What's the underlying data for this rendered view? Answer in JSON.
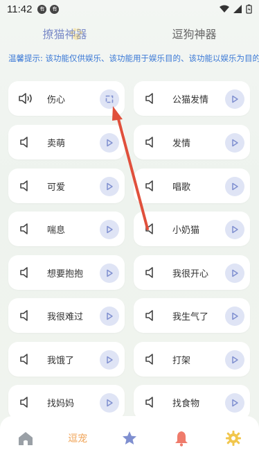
{
  "status": {
    "time": "11:42",
    "dot1": "有",
    "dot2": "有"
  },
  "tabs": [
    {
      "label": "撩猫神器",
      "active": true
    },
    {
      "label": "逗狗神器",
      "active": false
    }
  ],
  "notice": "温馨提示: 该功能仅供娱乐、该功能用于娱乐目的、该功能以娱乐为目的",
  "left_items": [
    {
      "label": "伤心"
    },
    {
      "label": "卖萌"
    },
    {
      "label": "可爱"
    },
    {
      "label": "喘息"
    },
    {
      "label": "想要抱抱"
    },
    {
      "label": "我很难过"
    },
    {
      "label": "我饿了"
    },
    {
      "label": "找妈妈"
    }
  ],
  "right_items": [
    {
      "label": "公猫发情"
    },
    {
      "label": "发情"
    },
    {
      "label": "唱歌"
    },
    {
      "label": "小奶猫"
    },
    {
      "label": "我很开心"
    },
    {
      "label": "我生气了"
    },
    {
      "label": "打架"
    },
    {
      "label": "找食物"
    }
  ],
  "nav": [
    {
      "icon": "home-icon",
      "color": "#9aa0a6"
    },
    {
      "label": "逗宠",
      "color": "#f0a55a"
    },
    {
      "icon": "star-icon",
      "color": "#7f8fd0"
    },
    {
      "icon": "bell-icon",
      "color": "#ef7b6b"
    },
    {
      "icon": "gear-icon",
      "color": "#f1c64c"
    }
  ],
  "colors": {
    "accent": "#7c8cc8",
    "notice": "#3a78d6",
    "arrow": "#e0503c"
  }
}
